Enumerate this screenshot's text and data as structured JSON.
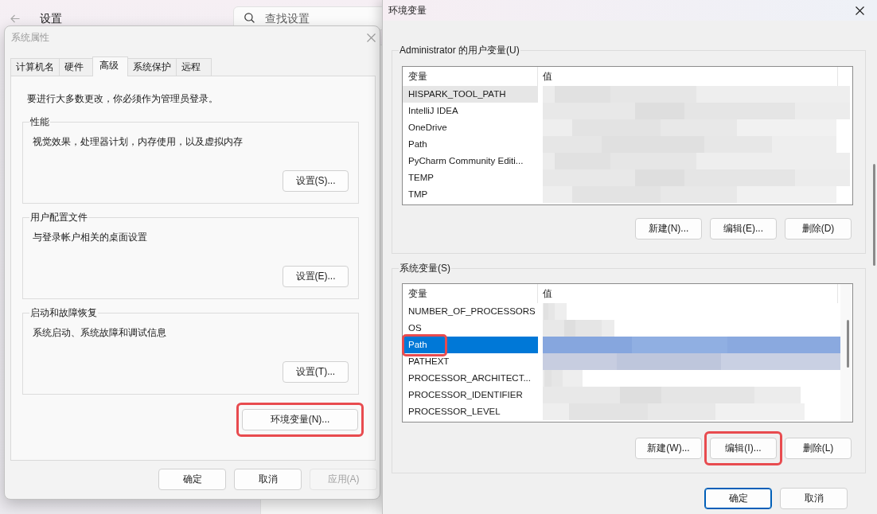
{
  "settings_window": {
    "title": "设置",
    "search": {
      "placeholder": "查找设置"
    }
  },
  "system_properties": {
    "title": "系统属性",
    "active": false,
    "tabs": [
      {
        "label": "计算机名",
        "selected": false
      },
      {
        "label": "硬件",
        "selected": false
      },
      {
        "label": "高级",
        "selected": true
      },
      {
        "label": "系统保护",
        "selected": false
      },
      {
        "label": "远程",
        "selected": false
      }
    ],
    "notice": "要进行大多数更改，你必须作为管理员登录。",
    "groups": [
      {
        "title": "性能",
        "description": "视觉效果，处理器计划，内存使用，以及虚拟内存",
        "button": {
          "label": "设置(S)...",
          "highlighted": false
        }
      },
      {
        "title": "用户配置文件",
        "description": "与登录帐户相关的桌面设置",
        "button": {
          "label": "设置(E)...",
          "highlighted": false
        }
      },
      {
        "title": "启动和故障恢复",
        "description": "系统启动、系统故障和调试信息",
        "button": {
          "label": "设置(T)...",
          "highlighted": false
        }
      }
    ],
    "environment_button": {
      "label": "环境变量(N)...",
      "highlighted": true
    },
    "buttons": [
      {
        "label": "确定",
        "disabled": false
      },
      {
        "label": "取消",
        "disabled": false
      },
      {
        "label": "应用(A)",
        "disabled": true
      }
    ]
  },
  "environment_variables": {
    "title": "环境变量",
    "active": true,
    "user_variables": {
      "title": "Administrator 的用户变量(U)",
      "focused": false,
      "columns": [
        "变量",
        "值"
      ],
      "rows": [
        {
          "name": "HISPARK_TOOL_PATH",
          "selected": true,
          "highlighted": false
        },
        {
          "name": "IntelliJ IDEA",
          "selected": false,
          "highlighted": false
        },
        {
          "name": "OneDrive",
          "selected": false,
          "highlighted": false
        },
        {
          "name": "Path",
          "selected": false,
          "highlighted": false
        },
        {
          "name": "PyCharm Community Editi...",
          "selected": false,
          "highlighted": false
        },
        {
          "name": "TEMP",
          "selected": false,
          "highlighted": false
        },
        {
          "name": "TMP",
          "selected": false,
          "highlighted": false
        }
      ],
      "buttons": [
        {
          "label": "新建(N)...",
          "highlighted": false
        },
        {
          "label": "编辑(E)...",
          "highlighted": false
        },
        {
          "label": "删除(D)",
          "highlighted": false
        }
      ]
    },
    "system_variables": {
      "title": "系统变量(S)",
      "focused": true,
      "columns": [
        "变量",
        "值"
      ],
      "rows": [
        {
          "name": "NUMBER_OF_PROCESSORS",
          "selected": false,
          "highlighted": false
        },
        {
          "name": "OS",
          "selected": false,
          "highlighted": false
        },
        {
          "name": "Path",
          "selected": true,
          "highlighted": true
        },
        {
          "name": "PATHEXT",
          "selected": false,
          "highlighted": false
        },
        {
          "name": "PROCESSOR_ARCHITECT...",
          "selected": false,
          "highlighted": false
        },
        {
          "name": "PROCESSOR_IDENTIFIER",
          "selected": false,
          "highlighted": false
        },
        {
          "name": "PROCESSOR_LEVEL",
          "selected": false,
          "highlighted": false
        }
      ],
      "buttons": [
        {
          "label": "新建(W)...",
          "highlighted": false
        },
        {
          "label": "编辑(I)...",
          "highlighted": true
        },
        {
          "label": "删除(L)",
          "highlighted": false
        }
      ]
    },
    "buttons": [
      {
        "label": "确定",
        "default": true
      },
      {
        "label": "取消",
        "default": false
      }
    ]
  }
}
